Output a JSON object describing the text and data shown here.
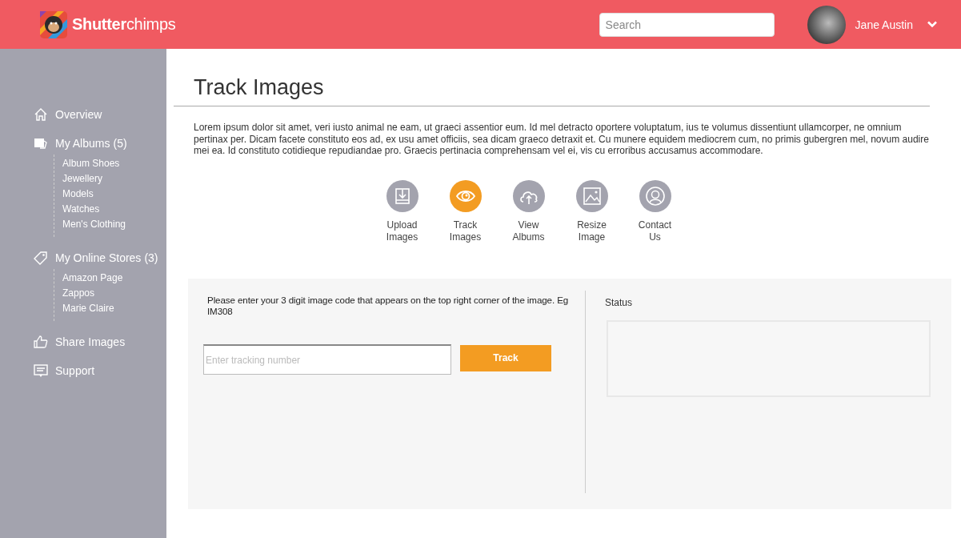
{
  "header": {
    "logo": "**Shutter**chimps",
    "search": {
      "placeholder": "Search"
    },
    "user": {
      "name": "Jane Austin"
    }
  },
  "sidebar": {
    "items": [
      {
        "label": "Overview"
      },
      {
        "label": "My Albums",
        "count": "(5)",
        "children": [
          {
            "label": "Album Shoes"
          },
          {
            "label": "Jewellery"
          },
          {
            "label": "Models"
          },
          {
            "label": "Watches"
          },
          {
            "label": "Men's Clothing"
          }
        ]
      },
      {
        "label": "My Online Stores",
        "count": "(3)",
        "children": [
          {
            "label": "Amazon Page"
          },
          {
            "label": "Zappos"
          },
          {
            "label": "Marie Claire"
          }
        ]
      },
      {
        "label": "Share Images"
      },
      {
        "label": "Support"
      }
    ]
  },
  "page": {
    "title": "Track Images",
    "intro": "Lorem ipsum dolor sit amet, veri iusto animal ne eam, ut graeci assentior eum. Id mel detracto oportere voluptatum, ius te volumus dissentiunt ullamcorper, ne omnium pertinax per. Dicam facete constituto eos ad, ex usu amet officiis, sea dicam graeco detraxit et. Cu munere equidem mediocrem cum, no primis gubergren mel, novum audire mei ea. Id constituto cotidieque repudiandae pro. Graecis pertinacia comprehensam vel ei, vis cu erroribus accusamus accommodare.",
    "actions": [
      {
        "label": "Upload Images",
        "selected": false
      },
      {
        "label": "Track Images",
        "selected": true
      },
      {
        "label": "View Albums",
        "selected": false
      },
      {
        "label": "Resize Image",
        "selected": false
      },
      {
        "label": "Contact Us",
        "selected": false
      }
    ]
  },
  "tracker": {
    "instruction": "Please enter your 3 digit image code that appears on the top right corner of the image. Eg IM308",
    "input": {
      "placeholder": "Enter tracking number"
    },
    "button": "Track",
    "status_label": "Status"
  }
}
